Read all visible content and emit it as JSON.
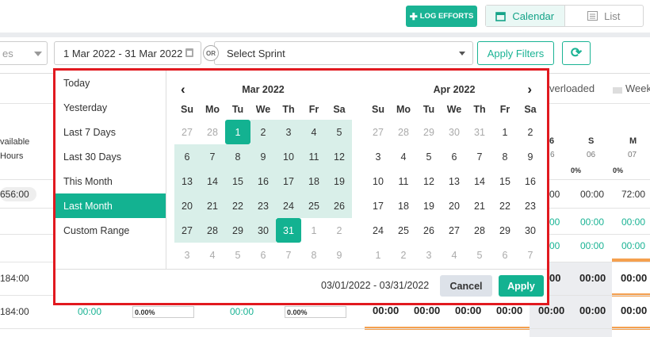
{
  "topbar": {
    "log_efforts": "LOG EFFORTS",
    "calendar": "Calendar",
    "list": "List"
  },
  "filters": {
    "left_select": "es",
    "date_range": "1 Mar 2022 - 31 Mar 2022",
    "or": "OR",
    "sprint_placeholder": "Select Sprint",
    "apply": "Apply Filters"
  },
  "background": {
    "legend_overloaded": "verloaded",
    "legend_week": "Week",
    "available": "vailable",
    "hours": "Hours",
    "total_pill": "656:00",
    "col_s_day": "S",
    "col_s_date": "06",
    "col_m_day": "M",
    "col_m_date": "07",
    "col_partial_day": "6",
    "pct_zero": "0%",
    "v0000": "00:00",
    "v7200": "72:00",
    "v18400": "184:00",
    "pct_000": "0.00%",
    "partial_0": "00"
  },
  "picker": {
    "ranges": [
      "Today",
      "Yesterday",
      "Last 7 Days",
      "Last 30 Days",
      "This Month",
      "Last Month",
      "Custom Range"
    ],
    "active_range": 5,
    "weekdays": [
      "Su",
      "Mo",
      "Tu",
      "We",
      "Th",
      "Fr",
      "Sa"
    ],
    "left_month": "Mar 2022",
    "right_month": "Apr 2022",
    "left_days": [
      "27",
      "28",
      "1",
      "2",
      "3",
      "4",
      "5",
      "6",
      "7",
      "8",
      "9",
      "10",
      "11",
      "12",
      "13",
      "14",
      "15",
      "16",
      "17",
      "18",
      "19",
      "20",
      "21",
      "22",
      "23",
      "24",
      "25",
      "26",
      "27",
      "28",
      "29",
      "30",
      "31",
      "1",
      "2",
      "3",
      "4",
      "5",
      "6",
      "7",
      "8",
      "9"
    ],
    "right_days": [
      "27",
      "28",
      "29",
      "30",
      "31",
      "1",
      "2",
      "3",
      "4",
      "5",
      "6",
      "7",
      "8",
      "9",
      "10",
      "11",
      "12",
      "13",
      "14",
      "15",
      "16",
      "17",
      "18",
      "19",
      "20",
      "21",
      "22",
      "23",
      "24",
      "25",
      "26",
      "27",
      "28",
      "29",
      "30",
      "1",
      "2",
      "3",
      "4",
      "5",
      "6",
      "7"
    ],
    "footer_range": "03/01/2022 - 03/31/2022",
    "cancel": "Cancel",
    "apply": "Apply"
  }
}
